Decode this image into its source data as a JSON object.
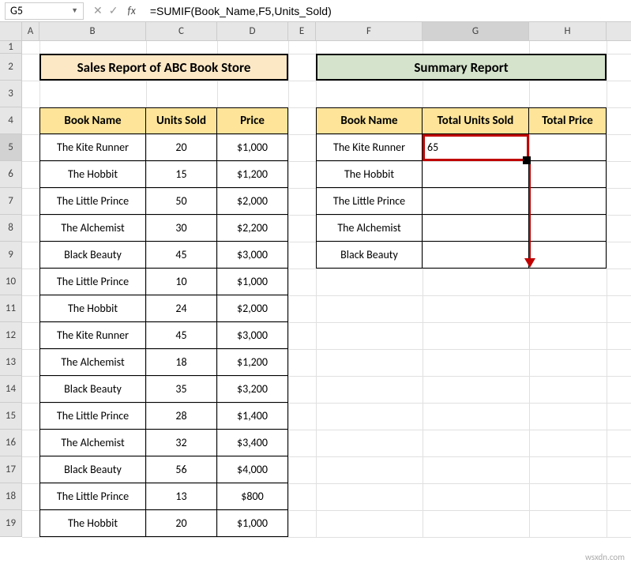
{
  "namebox": "G5",
  "formula": "=SUMIF(Book_Name,F5,Units_Sold)",
  "columns": [
    "A",
    "B",
    "C",
    "D",
    "E",
    "F",
    "G",
    "H"
  ],
  "rows": [
    "1",
    "2",
    "3",
    "4",
    "5",
    "6",
    "7",
    "8",
    "9",
    "10",
    "11",
    "12",
    "13",
    "14",
    "15",
    "16",
    "17",
    "18",
    "19"
  ],
  "sales": {
    "title": "Sales Report of ABC Book Store",
    "headers": {
      "b": "Book Name",
      "c": "Units Sold",
      "d": "Price"
    },
    "data": [
      {
        "b": "The Kite Runner",
        "c": "20",
        "d": "$1,000"
      },
      {
        "b": "The Hobbit",
        "c": "15",
        "d": "$1,200"
      },
      {
        "b": "The Little Prince",
        "c": "50",
        "d": "$2,000"
      },
      {
        "b": "The Alchemist",
        "c": "30",
        "d": "$2,200"
      },
      {
        "b": "Black Beauty",
        "c": "45",
        "d": "$3,000"
      },
      {
        "b": "The Little Prince",
        "c": "10",
        "d": "$1,000"
      },
      {
        "b": "The Hobbit",
        "c": "24",
        "d": "$2,000"
      },
      {
        "b": "The Kite Runner",
        "c": "45",
        "d": "$3,000"
      },
      {
        "b": "The Alchemist",
        "c": "18",
        "d": "$1,200"
      },
      {
        "b": "Black Beauty",
        "c": "35",
        "d": "$3,200"
      },
      {
        "b": "The Little Prince",
        "c": "28",
        "d": "$1,400"
      },
      {
        "b": "The Alchemist",
        "c": "32",
        "d": "$3,400"
      },
      {
        "b": "Black Beauty",
        "c": "56",
        "d": "$4,000"
      },
      {
        "b": "The Little Prince",
        "c": "13",
        "d": "$800"
      },
      {
        "b": "The Hobbit",
        "c": "20",
        "d": "$1,000"
      }
    ]
  },
  "summary": {
    "title": "Summary Report",
    "headers": {
      "f": "Book Name",
      "g": "Total Units Sold",
      "h": "Total Price"
    },
    "data": [
      {
        "f": "The Kite Runner",
        "g": "65",
        "h": ""
      },
      {
        "f": "The Hobbit",
        "g": "",
        "h": ""
      },
      {
        "f": "The Little Prince",
        "g": "",
        "h": ""
      },
      {
        "f": "The Alchemist",
        "g": "",
        "h": ""
      },
      {
        "f": "Black Beauty",
        "g": "",
        "h": ""
      }
    ]
  },
  "watermark": "wsxdn.com"
}
